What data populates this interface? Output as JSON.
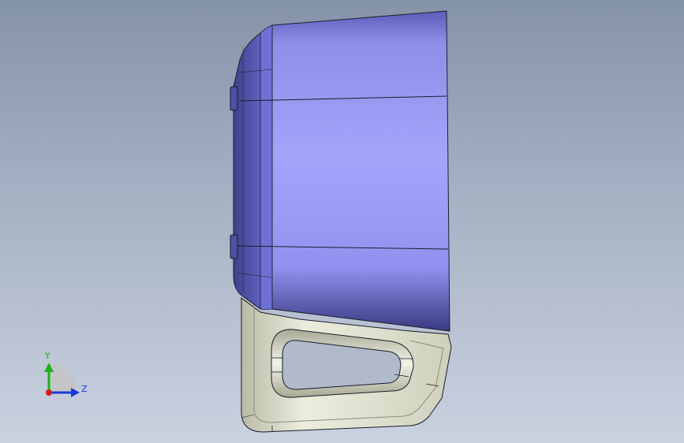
{
  "viewport": {
    "background_top": "#8593a9",
    "background_bottom": "#c9d2df"
  },
  "model": {
    "body_color": "#9a9cf6",
    "body_dark": "#4b4d9c",
    "bracket_color": "#d6d7c4",
    "bracket_shadow": "#a9aa96",
    "edge_color": "#1c1c2c"
  },
  "triad": {
    "y_label": "Y",
    "z_label": "Z",
    "y_color": "#19b31b",
    "z_color": "#1a3ad8",
    "origin_color": "#d81818"
  }
}
